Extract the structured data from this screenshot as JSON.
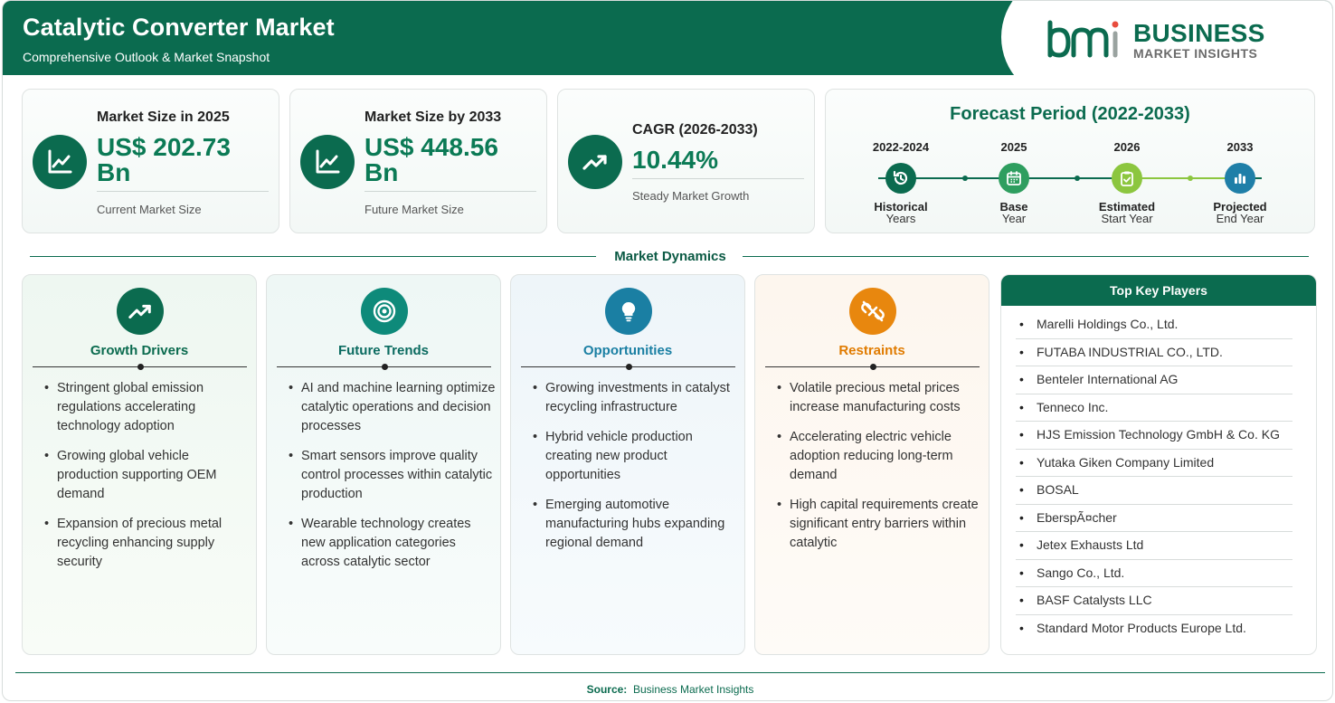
{
  "header": {
    "title": "Catalytic Converter Market",
    "subtitle": "Comprehensive Outlook & Market Snapshot",
    "logo_line1": "BUSINESS",
    "logo_line2": "MARKET INSIGHTS"
  },
  "stats": [
    {
      "label": "Market Size in 2025",
      "value_line1": "US$ 202.73",
      "value_line2": "Bn",
      "note": "Current Market Size",
      "icon": "chart-line-icon"
    },
    {
      "label": "Market Size by 2033",
      "value_line1": "US$ 448.56",
      "value_line2": "Bn",
      "note": "Future Market Size",
      "icon": "chart-line-icon"
    },
    {
      "label": "CAGR (2026-2033)",
      "value_line1": "10.44%",
      "value_line2": "",
      "note": "Steady Market Growth",
      "icon": "trending-up-icon"
    }
  ],
  "forecast": {
    "title": "Forecast Period (2022-2033)",
    "steps": [
      {
        "year": "2022-2024",
        "label1": "Historical",
        "label2": "Years",
        "icon": "history-icon",
        "color": "#0b6b4f"
      },
      {
        "year": "2025",
        "label1": "Base",
        "label2": "Year",
        "icon": "calendar-icon",
        "color": "#2e9e5f"
      },
      {
        "year": "2026",
        "label1": "Estimated",
        "label2": "Start Year",
        "icon": "clipboard-check-icon",
        "color": "#8cc63f"
      },
      {
        "year": "2033",
        "label1": "Projected",
        "label2": "End Year",
        "icon": "bar-chart-icon",
        "color": "#1f7fa8"
      }
    ]
  },
  "dynamics": {
    "title": "Market Dynamics",
    "columns": [
      {
        "title": "Growth Drivers",
        "color": "#0b6b4f",
        "icon": "trending-up-icon",
        "items": [
          "Stringent global emission regulations accelerating technology adoption",
          "Growing global vehicle production supporting OEM demand",
          "Expansion of precious metal recycling enhancing supply security"
        ]
      },
      {
        "title": "Future Trends",
        "color": "#0e8a7a",
        "icon": "target-icon",
        "items": [
          "AI and machine learning optimize catalytic operations and decision processes",
          "Smart sensors improve quality control processes within catalytic production",
          "Wearable technology creates new application categories across catalytic sector"
        ]
      },
      {
        "title": "Opportunities",
        "color": "#1a7fa3",
        "icon": "lightbulb-icon",
        "items": [
          "Growing investments in catalyst recycling infrastructure",
          "Hybrid vehicle production creating new product opportunities",
          "Emerging automotive manufacturing hubs expanding regional demand"
        ]
      },
      {
        "title": "Restraints",
        "color": "#e8870e",
        "icon": "broken-link-icon",
        "items": [
          "Volatile precious metal prices increase manufacturing costs",
          "Accelerating electric vehicle adoption reducing long-term demand",
          "High capital requirements create significant entry barriers within catalytic"
        ]
      }
    ]
  },
  "key_players": {
    "title": "Top Key Players",
    "items": [
      "Marelli Holdings Co., Ltd.",
      "FUTABA INDUSTRIAL CO., LTD.",
      "Benteler International AG",
      "Tenneco Inc.",
      "HJS Emission Technology GmbH & Co. KG",
      "Yutaka Giken Company Limited",
      "BOSAL",
      "EberspÃ¤cher",
      "Jetex Exhausts Ltd",
      "Sango Co., Ltd.",
      "BASF Catalysts LLC",
      "Standard Motor Products Europe Ltd."
    ]
  },
  "footer": {
    "source_label": "Source:",
    "source_value": "Business Market Insights"
  }
}
